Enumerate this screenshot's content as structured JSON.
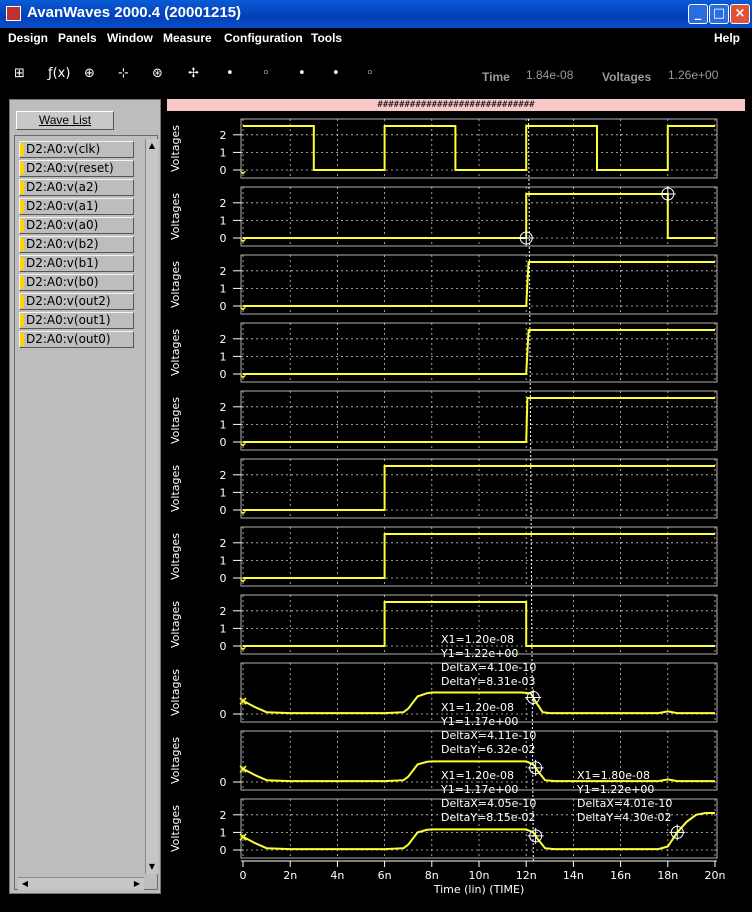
{
  "window": {
    "title": "AvanWaves 2000.4  (20001215)"
  },
  "menu": {
    "items": [
      "Design",
      "Panels",
      "Window",
      "Measure",
      "Configuration",
      "Tools"
    ],
    "help": "Help"
  },
  "toolbar": {
    "tools": [
      "hierarchy-icon",
      "function-icon",
      "panel-add-icon",
      "add-panel-icon",
      "zoom-icon",
      "cursor-icon",
      "marker-icon",
      "scroll-left-icon",
      "scroll-right-icon",
      "marker-down-icon"
    ],
    "time_label": "Time",
    "time_value": "1.84e-08",
    "voltage_label": "Voltages",
    "voltage_value": "1.26e+00"
  },
  "wave_list": {
    "button_label": "Wave List",
    "items": [
      "D2:A0:v(clk)",
      "D2:A0:v(reset)",
      "D2:A0:v(a2)",
      "D2:A0:v(a1)",
      "D2:A0:v(a0)",
      "D2:A0:v(b2)",
      "D2:A0:v(b1)",
      "D2:A0:v(b0)",
      "D2:A0:v(out2)",
      "D2:A0:v(out1)",
      "D2:A0:v(out0)"
    ]
  },
  "plot": {
    "header": "#############################",
    "ylabel": "Voltages",
    "xlabel": "Time (lin) (TIME)",
    "trace_color": "#ffff33",
    "grid_color": "#c8c8c8",
    "x_ticks": [
      "0",
      "2n",
      "4n",
      "6n",
      "8n",
      "10n",
      "12n",
      "14n",
      "16n",
      "18n",
      "20n"
    ],
    "digital_ticks": [
      "2",
      "1",
      "0"
    ],
    "analog_ticks_single": [
      "0"
    ],
    "analog_ticks_double": [
      "2",
      "1",
      "0"
    ]
  },
  "chart_data": {
    "type": "line",
    "x_unit": "ns",
    "xlim": [
      0,
      20
    ],
    "xlabel": "Time (lin) (TIME)",
    "ylabel": "Voltages",
    "ylim": [
      0,
      2.5
    ],
    "series": [
      {
        "name": "D2:A0:v(clk)",
        "points": [
          [
            0,
            2.5
          ],
          [
            3,
            2.5
          ],
          [
            3,
            0
          ],
          [
            6,
            0
          ],
          [
            6,
            2.5
          ],
          [
            9,
            2.5
          ],
          [
            9,
            0
          ],
          [
            12,
            0
          ],
          [
            12,
            2.5
          ],
          [
            15,
            2.5
          ],
          [
            15,
            0
          ],
          [
            18,
            0
          ],
          [
            18,
            2.5
          ],
          [
            20,
            2.5
          ]
        ]
      },
      {
        "name": "D2:A0:v(reset)",
        "points": [
          [
            0,
            0
          ],
          [
            12,
            0
          ],
          [
            12,
            2.5
          ],
          [
            18,
            2.5
          ],
          [
            18,
            0
          ],
          [
            20,
            0
          ]
        ]
      },
      {
        "name": "D2:A0:v(a2)",
        "points": [
          [
            0,
            0
          ],
          [
            12,
            0
          ],
          [
            12.1,
            2.5
          ],
          [
            20,
            2.5
          ]
        ]
      },
      {
        "name": "D2:A0:v(a1)",
        "points": [
          [
            0,
            0
          ],
          [
            12,
            0
          ],
          [
            12.1,
            2.5
          ],
          [
            20,
            2.5
          ]
        ]
      },
      {
        "name": "D2:A0:v(a0)",
        "points": [
          [
            0,
            0
          ],
          [
            12,
            0
          ],
          [
            12.05,
            2.5
          ],
          [
            20,
            2.5
          ]
        ]
      },
      {
        "name": "D2:A0:v(b2)",
        "points": [
          [
            0,
            0
          ],
          [
            6,
            0
          ],
          [
            6,
            2.5
          ],
          [
            20,
            2.5
          ]
        ]
      },
      {
        "name": "D2:A0:v(b1)",
        "points": [
          [
            0,
            0
          ],
          [
            6,
            0
          ],
          [
            6,
            2.5
          ],
          [
            20,
            2.5
          ]
        ]
      },
      {
        "name": "D2:A0:v(b0)",
        "points": [
          [
            0,
            0
          ],
          [
            6,
            0
          ],
          [
            6,
            2.5
          ],
          [
            12,
            2.5
          ],
          [
            12,
            0
          ],
          [
            20,
            0
          ]
        ]
      },
      {
        "name": "D2:A0:v(out2)",
        "points": [
          [
            0,
            0.75
          ],
          [
            0.5,
            0.4
          ],
          [
            1,
            0.1
          ],
          [
            2,
            0.05
          ],
          [
            6,
            0.05
          ],
          [
            6.8,
            0.1
          ],
          [
            7,
            0.3
          ],
          [
            7.4,
            1.0
          ],
          [
            7.8,
            1.18
          ],
          [
            8,
            1.22
          ],
          [
            11.8,
            1.22
          ],
          [
            12,
            1.2
          ],
          [
            12.2,
            1.17
          ],
          [
            12.4,
            0.7
          ],
          [
            12.7,
            0.1
          ],
          [
            13,
            0.05
          ],
          [
            17.6,
            0.05
          ],
          [
            18,
            0.15
          ],
          [
            18.4,
            0.05
          ],
          [
            20,
            0.05
          ]
        ]
      },
      {
        "name": "D2:A0:v(out1)",
        "points": [
          [
            0,
            0.75
          ],
          [
            0.5,
            0.4
          ],
          [
            1,
            0.1
          ],
          [
            2,
            0.05
          ],
          [
            6,
            0.05
          ],
          [
            6.8,
            0.1
          ],
          [
            7,
            0.3
          ],
          [
            7.4,
            1.0
          ],
          [
            7.8,
            1.15
          ],
          [
            8,
            1.17
          ],
          [
            11.8,
            1.17
          ],
          [
            12,
            1.17
          ],
          [
            12.3,
            1.0
          ],
          [
            12.5,
            0.6
          ],
          [
            12.8,
            0.1
          ],
          [
            13.2,
            0.05
          ],
          [
            17.6,
            0.05
          ],
          [
            18,
            0.15
          ],
          [
            18.4,
            0.05
          ],
          [
            20,
            0.05
          ]
        ]
      },
      {
        "name": "D2:A0:v(out0)",
        "points": [
          [
            0,
            0.75
          ],
          [
            0.5,
            0.4
          ],
          [
            1,
            0.1
          ],
          [
            2,
            0.05
          ],
          [
            6,
            0.05
          ],
          [
            6.8,
            0.1
          ],
          [
            7,
            0.3
          ],
          [
            7.4,
            1.0
          ],
          [
            7.8,
            1.15
          ],
          [
            8,
            1.17
          ],
          [
            11.8,
            1.17
          ],
          [
            12,
            1.17
          ],
          [
            12.3,
            1.0
          ],
          [
            12.5,
            0.6
          ],
          [
            12.8,
            0.1
          ],
          [
            13.2,
            0.05
          ],
          [
            17.6,
            0.05
          ],
          [
            18,
            0.2
          ],
          [
            18.4,
            1.0
          ],
          [
            18.8,
            1.6
          ],
          [
            19.2,
            2.0
          ],
          [
            19.6,
            2.1
          ],
          [
            20,
            2.1
          ]
        ]
      }
    ],
    "cursors": [
      {
        "panel": 1,
        "x": 12
      },
      {
        "panel": 1,
        "x": 18
      },
      {
        "panel": 8,
        "x": 12.3
      },
      {
        "panel": 9,
        "x": 12.4
      },
      {
        "panel": 10,
        "x": 12.4
      },
      {
        "panel": 10,
        "x": 18.4
      }
    ],
    "measurements": [
      {
        "panel": 8,
        "lines": [
          "X1=1.20e-08",
          "Y1=1.22e+00",
          "DeltaX=4.10e-10",
          "DeltaY=8.31e-03"
        ]
      },
      {
        "panel": 9,
        "lines": [
          "X1=1.20e-08",
          "Y1=1.17e+00",
          "DeltaX=4.11e-10",
          "DeltaY=6.32e-02"
        ]
      },
      {
        "panel": 10,
        "lines": [
          "X1=1.20e-08",
          "Y1=1.17e+00",
          "DeltaX=4.05e-10",
          "DeltaY=8.15e-02"
        ]
      },
      {
        "panel": 10,
        "lines": [
          "X1=1.80e-08",
          "Y1=1.22e+00",
          "DeltaX=4.01e-10",
          "DeltaY=4.30e-02"
        ]
      }
    ],
    "grid": true
  }
}
